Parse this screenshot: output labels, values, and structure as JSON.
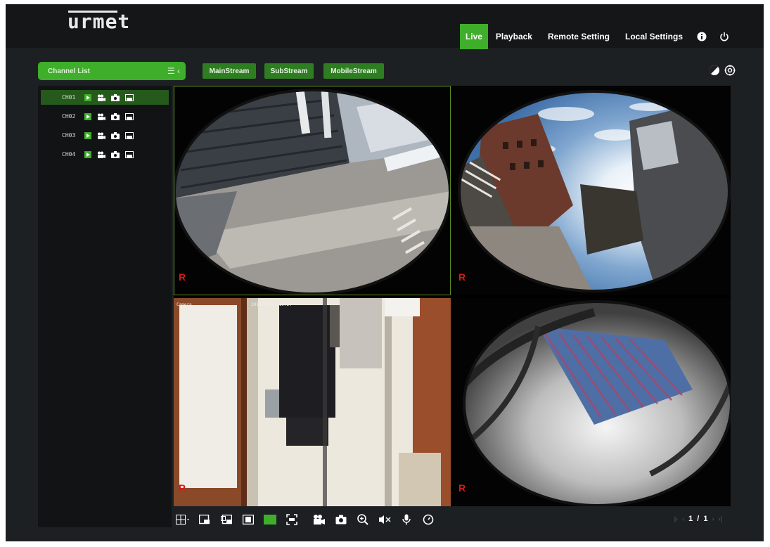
{
  "brand": {
    "logo_text": "urmet"
  },
  "nav": {
    "items": [
      {
        "label": "Live",
        "active": true
      },
      {
        "label": "Playback",
        "active": false
      },
      {
        "label": "Remote Setting",
        "active": false
      },
      {
        "label": "Local Settings",
        "active": false
      }
    ],
    "icons": [
      "info-icon",
      "power-icon"
    ]
  },
  "toolbar": {
    "channel_list_label": "Channel List",
    "channel_list_menu": "☰ ‹",
    "streams": [
      "MainStream",
      "SubStream",
      "MobileStream"
    ],
    "right_icons": [
      "contrast-icon",
      "settings-icon"
    ]
  },
  "channels": [
    {
      "name": "CH01",
      "selected": true
    },
    {
      "name": "CH02",
      "selected": false
    },
    {
      "name": "CH03",
      "selected": false
    },
    {
      "name": "CH04",
      "selected": false
    }
  ],
  "cells": [
    {
      "rec_label": "R",
      "osd_left": "",
      "osd_time": ""
    },
    {
      "rec_label": "R",
      "osd_left": "",
      "osd_time": ""
    },
    {
      "rec_label": "R",
      "osd_left": "Camera",
      "osd_time": "2019/07/15 10:24"
    },
    {
      "rec_label": "R",
      "osd_left": "",
      "osd_time": ""
    }
  ],
  "controls": {
    "icons": [
      "layout-grid-icon",
      "prev-screen-icon",
      "next-screen-icon",
      "fullscreen-icon",
      "stream-toggle-icon",
      "fit-icon",
      "record-all-icon",
      "snapshot-icon",
      "zoom-icon",
      "mute-icon",
      "microphone-icon",
      "timer-icon"
    ]
  },
  "pager": {
    "first": "|‹",
    "prev": "‹",
    "current": "1",
    "sep": "/",
    "total": "1",
    "next": "›",
    "last": "›|"
  },
  "colors": {
    "accent": "#3fae2a",
    "accent_dark": "#2f7d22",
    "rec": "#d21c1c"
  }
}
